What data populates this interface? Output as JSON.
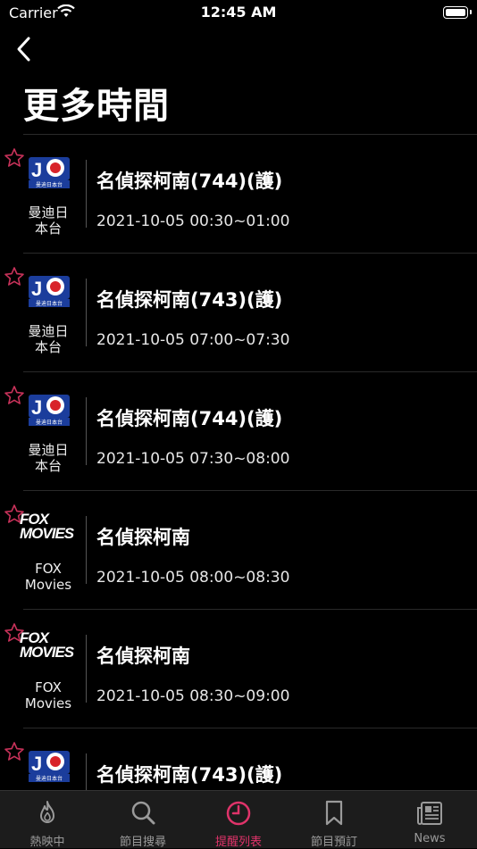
{
  "status_bar": {
    "carrier": "Carrier",
    "time": "12:45 AM"
  },
  "nav": {
    "title": "更多時間"
  },
  "rows": [
    {
      "channel_line1": "曼迪日",
      "channel_line2": "本台",
      "logo": "jp-logo",
      "logo_sub": "曼迪日本台",
      "title": "名偵探柯南(744)(護)",
      "time": "2021-10-05 00:30~01:00"
    },
    {
      "channel_line1": "曼迪日",
      "channel_line2": "本台",
      "logo": "jp-logo",
      "logo_sub": "曼迪日本台",
      "title": "名偵探柯南(743)(護)",
      "time": "2021-10-05 07:00~07:30"
    },
    {
      "channel_line1": "曼迪日",
      "channel_line2": "本台",
      "logo": "jp-logo",
      "logo_sub": "曼迪日本台",
      "title": "名偵探柯南(744)(護)",
      "time": "2021-10-05 07:30~08:00"
    },
    {
      "channel_line1": "FOX",
      "channel_line2": "Movies",
      "logo": "fox-logo",
      "logo_text1": "FOX",
      "logo_text2": "MOVIES",
      "title": "名偵探柯南",
      "time": "2021-10-05 08:00~08:30"
    },
    {
      "channel_line1": "FOX",
      "channel_line2": "Movies",
      "logo": "fox-logo",
      "logo_text1": "FOX",
      "logo_text2": "MOVIES",
      "title": "名偵探柯南",
      "time": "2021-10-05 08:30~09:00"
    },
    {
      "channel_line1": "曼迪日",
      "channel_line2": "本台",
      "logo": "jp-logo",
      "logo_sub": "曼迪日本台",
      "title": "名偵探柯南(743)(護)",
      "time": ""
    }
  ],
  "tabs": [
    {
      "label": "熱映中",
      "icon": "flame-icon",
      "active": false
    },
    {
      "label": "節目搜尋",
      "icon": "search-icon",
      "active": false
    },
    {
      "label": "提醒列表",
      "icon": "clock-icon",
      "active": true
    },
    {
      "label": "節目預訂",
      "icon": "bookmark-icon",
      "active": false
    },
    {
      "label": "News",
      "icon": "newspaper-icon",
      "active": false
    }
  ],
  "colors": {
    "accent": "#e0336a",
    "star": "#c8325a",
    "jp_blue": "#1b3d9c",
    "jp_red": "#d8232a"
  }
}
